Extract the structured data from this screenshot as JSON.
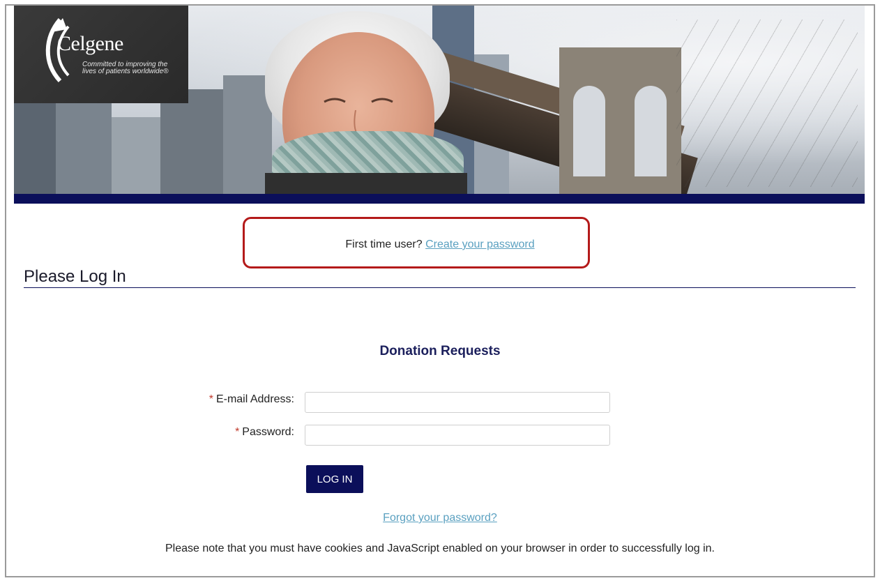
{
  "brand": {
    "name": "Celgene",
    "tagline": "Committed to improving the lives of patients worldwide®"
  },
  "banner": {
    "image": "woman-smiling-brooklyn-bridge-photo",
    "accent_color": "#0b0f5a"
  },
  "first_time": {
    "prompt": "First time user?",
    "link_label": "Create your password",
    "highlight_color": "#b41a1a"
  },
  "login": {
    "heading": "Please Log In",
    "section_title": "Donation Requests",
    "required_marker": "*",
    "email_label": "E-mail Address:",
    "email_value": "",
    "password_label": "Password:",
    "password_value": "",
    "submit_label": "LOG IN",
    "forgot_label": "Forgot your password?",
    "note": "Please note that you must have cookies and JavaScript enabled on your browser in order to successfully log in."
  }
}
